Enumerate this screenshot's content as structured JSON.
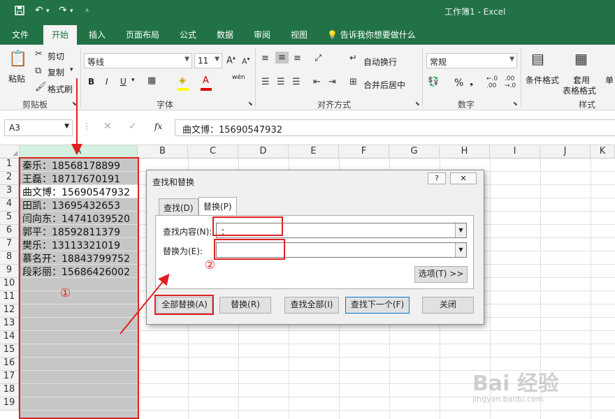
{
  "window": {
    "title": "工作簿1 - Excel",
    "quick_access": {
      "save_icon": "save-icon",
      "undo_icon": "undo-icon",
      "redo_icon": "redo-icon"
    }
  },
  "tabs": [
    "文件",
    "开始",
    "插入",
    "页面布局",
    "公式",
    "数据",
    "审阅",
    "视图"
  ],
  "tell_me": "告诉我你想要做什么",
  "ribbon": {
    "clipboard": {
      "paste": "粘贴",
      "cut": "剪切",
      "copy": "复制",
      "format_painter": "格式刷",
      "group": "剪贴板"
    },
    "font": {
      "name": "等线",
      "size": "11",
      "bold": "B",
      "italic": "I",
      "underline": "U",
      "wen": "wén",
      "group": "字体"
    },
    "alignment": {
      "wrap": "自动换行",
      "merge": "合并后居中",
      "group": "对齐方式"
    },
    "number": {
      "format": "常规",
      "percent": "%",
      "group": "数字"
    },
    "styles": {
      "conditional": "条件格式",
      "table_line1": "套用",
      "table_line2": "表格格式",
      "cell_styles": "单",
      "group": "样式"
    }
  },
  "formula_bar": {
    "name_box": "A3",
    "fx": "fx",
    "value": "曲文博：15690547932"
  },
  "columns": [
    "A",
    "B",
    "C",
    "D",
    "E",
    "F",
    "G",
    "H",
    "I",
    "J",
    "K"
  ],
  "rows": [
    "1",
    "2",
    "3",
    "4",
    "5",
    "6",
    "7",
    "8",
    "9",
    "10",
    "11",
    "12",
    "13",
    "14",
    "15",
    "16",
    "17",
    "18",
    "19"
  ],
  "cells": [
    "秦乐：18568178899",
    "王磊：18717670191",
    "曲文博：15690547932",
    "田凯：13695432653",
    "闫向东：14741039520",
    "郭平：18592811379",
    "樊乐：13113321019",
    "慕名开：18843799752",
    "段彩丽：15686426002"
  ],
  "annotations": {
    "circle1": "①",
    "circle2": "②"
  },
  "dialog": {
    "title": "查找和替换",
    "help": "?",
    "close": "✕",
    "tab_find": "查找(D)",
    "tab_replace": "替换(P)",
    "find_label": "查找内容(N):",
    "find_value": "：",
    "replace_label": "替换为(E):",
    "replace_value": "",
    "options": "选项(T) >>",
    "replace_all": "全部替换(A)",
    "replace": "替换(R)",
    "find_all": "查找全部(I)",
    "find_next": "查找下一个(F)",
    "close_btn": "关闭"
  },
  "watermark": {
    "logo": "Bai 经验",
    "url": "jingyan.baidu.com"
  },
  "colors": {
    "excel_green": "#217346",
    "annotation_red": "#e02020"
  }
}
